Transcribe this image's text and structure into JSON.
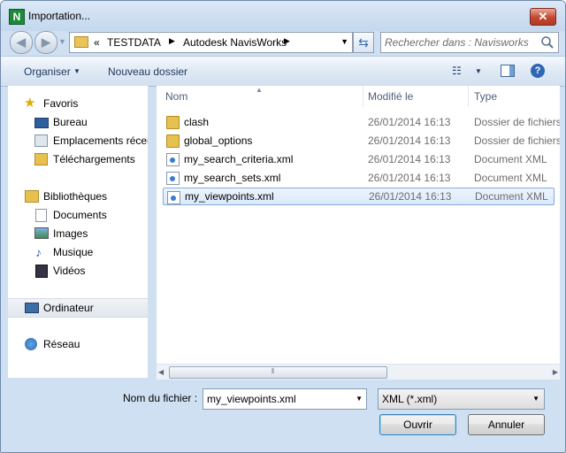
{
  "window": {
    "title": "Importation...",
    "app_icon_letter": "N",
    "close_glyph": "✕"
  },
  "nav": {
    "overflow": "«",
    "breadcrumbs": [
      "TESTDATA",
      "Autodesk NavisWorks"
    ],
    "search_placeholder": "Rechercher dans : Navisworks"
  },
  "toolbar": {
    "organise_label": "Organiser",
    "new_folder_label": "Nouveau dossier",
    "help_glyph": "?"
  },
  "sidebar": {
    "favorites": {
      "label": "Favoris",
      "items": [
        {
          "label": "Bureau",
          "icon": "desktop-icon"
        },
        {
          "label": "Emplacements récents",
          "icon": "recent-places-icon"
        },
        {
          "label": "Téléchargements",
          "icon": "downloads-icon"
        }
      ]
    },
    "libraries": {
      "label": "Bibliothèques",
      "items": [
        {
          "label": "Documents",
          "icon": "documents-icon"
        },
        {
          "label": "Images",
          "icon": "images-icon"
        },
        {
          "label": "Musique",
          "icon": "music-icon"
        },
        {
          "label": "Vidéos",
          "icon": "videos-icon"
        }
      ]
    },
    "computer": {
      "label": "Ordinateur"
    },
    "network": {
      "label": "Réseau"
    }
  },
  "file_list": {
    "columns": {
      "name": "Nom",
      "modified": "Modifié le",
      "type": "Type"
    },
    "rows": [
      {
        "name": "clash",
        "date": "26/01/2014 16:13",
        "type": "Dossier de fichiers",
        "kind": "folder"
      },
      {
        "name": "global_options",
        "date": "26/01/2014 16:13",
        "type": "Dossier de fichiers",
        "kind": "folder"
      },
      {
        "name": "my_search_criteria.xml",
        "date": "26/01/2014 16:13",
        "type": "Document XML",
        "kind": "xml"
      },
      {
        "name": "my_search_sets.xml",
        "date": "26/01/2014 16:13",
        "type": "Document XML",
        "kind": "xml"
      },
      {
        "name": "my_viewpoints.xml",
        "date": "26/01/2014 16:13",
        "type": "Document XML",
        "kind": "xml",
        "selected": true
      }
    ]
  },
  "footer": {
    "filename_label": "Nom du fichier :",
    "filename_value": "my_viewpoints.xml",
    "filter_value": "XML (*.xml)",
    "open_label": "Ouvrir",
    "cancel_label": "Annuler"
  },
  "colors": {
    "accent": "#2f67b4",
    "selection_border": "#84acdd",
    "selection_fill": "#d9e9fb"
  }
}
